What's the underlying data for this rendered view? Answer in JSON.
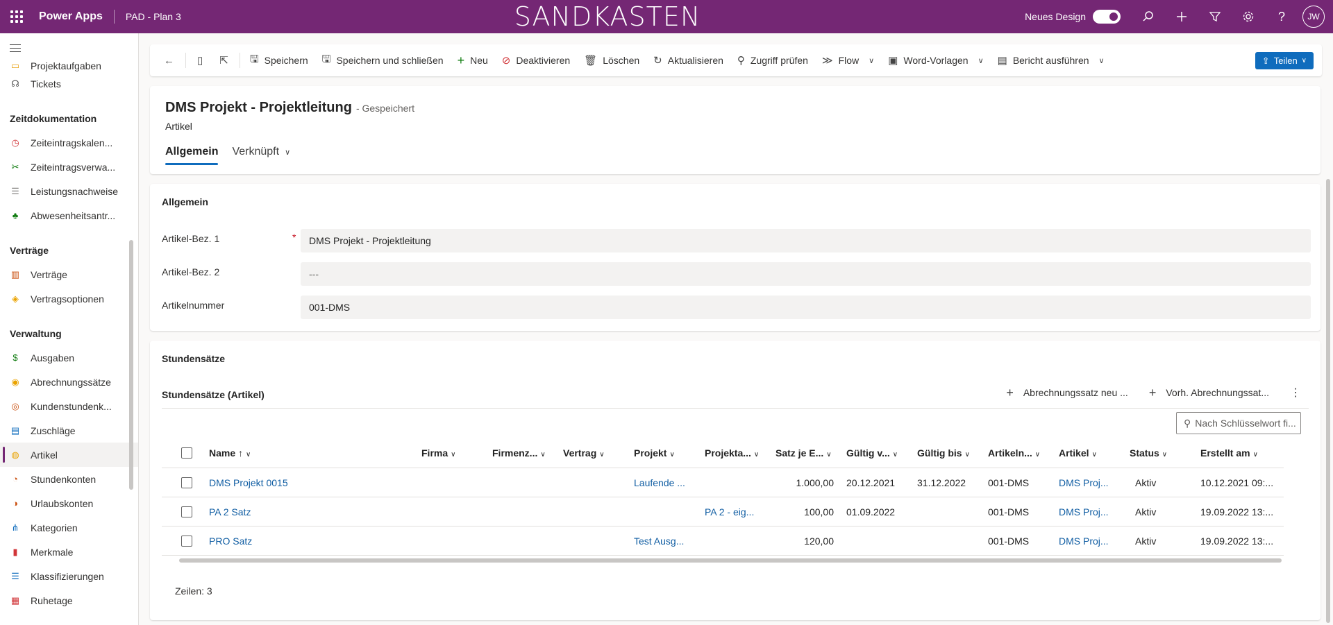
{
  "topbar": {
    "app_name": "Power Apps",
    "env_name": "PAD - Plan 3",
    "banner": "SANDKASTEN",
    "new_design_label": "Neues Design",
    "avatar_initials": "JW",
    "accent": "#742774"
  },
  "sidebar": {
    "items_top": [
      {
        "label": "Projektaufgaben",
        "icon": "tasks-icon"
      },
      {
        "label": "Tickets",
        "icon": "headset-icon"
      }
    ],
    "group_zeit": "Zeitdokumentation",
    "items_zeit": [
      {
        "label": "Zeiteintragskalen...",
        "icon": "clock-icon"
      },
      {
        "label": "Zeiteintragsverwa...",
        "icon": "tools-icon"
      },
      {
        "label": "Leistungsnachweise",
        "icon": "list-icon"
      },
      {
        "label": "Abwesenheitsantr...",
        "icon": "palm-icon"
      }
    ],
    "group_vertraege": "Verträge",
    "items_vertraege": [
      {
        "label": "Verträge",
        "icon": "books-icon"
      },
      {
        "label": "Vertragsoptionen",
        "icon": "tag-icon"
      }
    ],
    "group_verwaltung": "Verwaltung",
    "items_verwaltung": [
      {
        "label": "Ausgaben",
        "icon": "money-icon"
      },
      {
        "label": "Abrechnungssätze",
        "icon": "stopwatch-icon"
      },
      {
        "label": "Kundenstundenk...",
        "icon": "coins-icon"
      },
      {
        "label": "Zuschläge",
        "icon": "chart-icon"
      },
      {
        "label": "Artikel",
        "icon": "item-icon"
      },
      {
        "label": "Stundenkonten",
        "icon": "hours-icon"
      },
      {
        "label": "Urlaubskonten",
        "icon": "vacation-icon"
      },
      {
        "label": "Kategorien",
        "icon": "hierarchy-icon"
      },
      {
        "label": "Merkmale",
        "icon": "bookmark-icon"
      },
      {
        "label": "Klassifizierungen",
        "icon": "list-icon"
      },
      {
        "label": "Ruhetage",
        "icon": "calendar-icon"
      }
    ]
  },
  "commandbar": {
    "save": "Speichern",
    "save_close": "Speichern und schließen",
    "new": "Neu",
    "deactivate": "Deaktivieren",
    "delete": "Löschen",
    "refresh": "Aktualisieren",
    "check_access": "Zugriff prüfen",
    "flow": "Flow",
    "word_templates": "Word-Vorlagen",
    "run_report": "Bericht ausführen",
    "share": "Teilen"
  },
  "record": {
    "title": "DMS Projekt - Projektleitung",
    "status": "- Gespeichert",
    "entity": "Artikel",
    "tabs": [
      "Allgemein",
      "Verknüpft"
    ]
  },
  "general_section": {
    "title": "Allgemein",
    "fields": [
      {
        "label": "Artikel-Bez. 1",
        "value": "DMS Projekt - Projektleitung",
        "required": "*"
      },
      {
        "label": "Artikel-Bez. 2",
        "value": "---"
      },
      {
        "label": "Artikelnummer",
        "value": "001-DMS"
      }
    ]
  },
  "rates_section": {
    "title": "Stundensätze",
    "subgrid_title": "Stundensätze (Artikel)",
    "cmd_new_rate": "Abrechnungssatz neu ...",
    "cmd_existing_rate": "Vorh. Abrechnungssat...",
    "search_placeholder": "Nach Schlüsselwort fi...",
    "columns": [
      "Name ↑",
      "Firma",
      "Firmenz...",
      "Vertrag",
      "Projekt",
      "Projekta...",
      "Satz je E...",
      "Gültig v...",
      "Gültig bis",
      "Artikeln...",
      "Artikel",
      "Status",
      "Erstellt am"
    ],
    "rows": [
      [
        "DMS Projekt 0015",
        "",
        "",
        "",
        "Laufende ...",
        "",
        "1.000,00",
        "20.12.2021",
        "31.12.2022",
        "001-DMS",
        "DMS Proj...",
        "Aktiv",
        "10.12.2021 09:..."
      ],
      [
        "PA 2 Satz",
        "",
        "",
        "",
        "",
        "PA 2 - eig...",
        "100,00",
        "01.09.2022",
        "",
        "001-DMS",
        "DMS Proj...",
        "Aktiv",
        "19.09.2022 13:..."
      ],
      [
        "PRO Satz",
        "",
        "",
        "",
        "Test Ausg...",
        "",
        "120,00",
        "",
        "",
        "001-DMS",
        "DMS Proj...",
        "Aktiv",
        "19.09.2022 13:..."
      ]
    ],
    "row_count": "Zeilen: 3"
  }
}
